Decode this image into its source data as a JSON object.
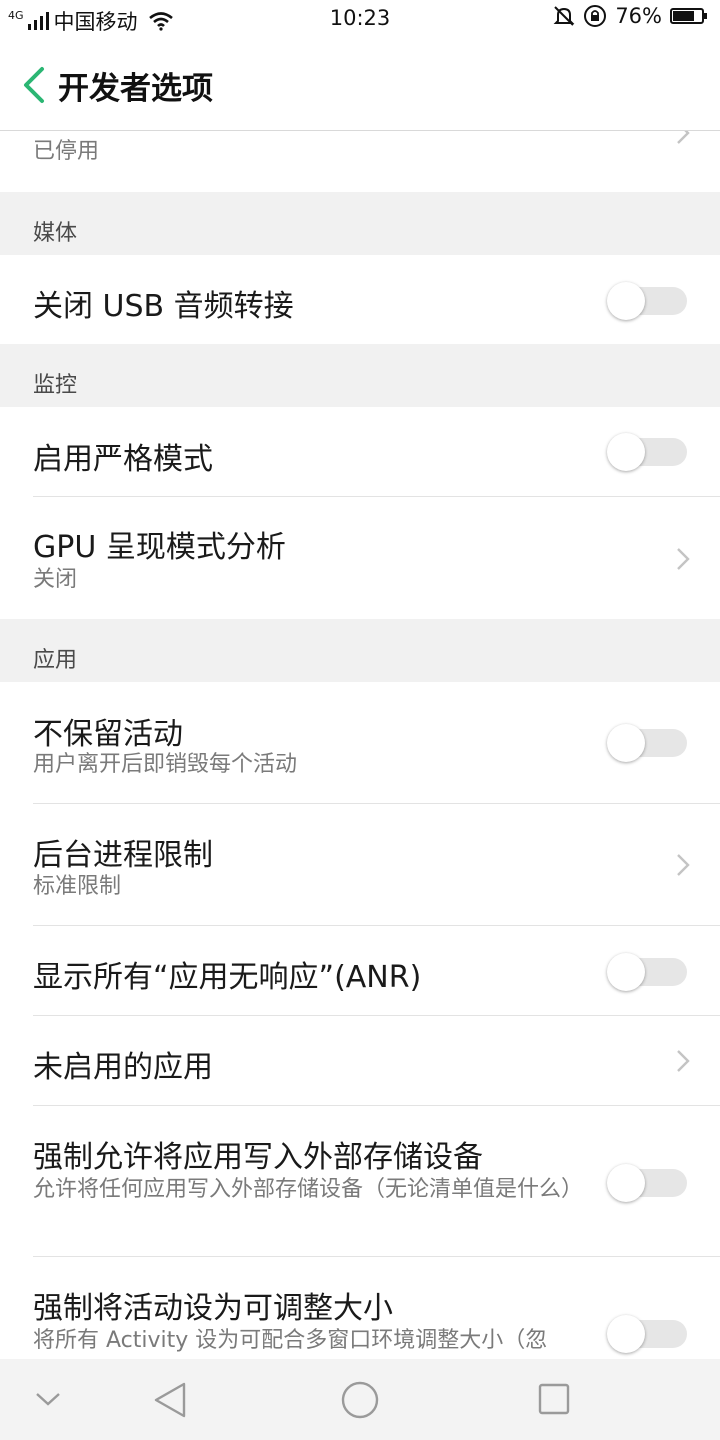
{
  "status_bar": {
    "network_type": "4G",
    "carrier": "中国移动",
    "time": "10:23",
    "battery_percent": "76%",
    "battery_level": 0.76
  },
  "header": {
    "title": "开发者选项"
  },
  "partial_top_row": {
    "summary": "已停用"
  },
  "sections": {
    "media": {
      "label": "媒体",
      "items": [
        {
          "title": "关闭 USB 音频转接",
          "control": "toggle",
          "on": false
        }
      ]
    },
    "monitoring": {
      "label": "监控",
      "items": [
        {
          "title": "启用严格模式",
          "control": "toggle",
          "on": false
        },
        {
          "title": "GPU 呈现模式分析",
          "summary": "关闭",
          "control": "chevron"
        }
      ]
    },
    "apps": {
      "label": "应用",
      "items": [
        {
          "title": "不保留活动",
          "summary": "用户离开后即销毁每个活动",
          "control": "toggle",
          "on": false
        },
        {
          "title": "后台进程限制",
          "summary": "标准限制",
          "control": "chevron"
        },
        {
          "title": "显示所有“应用无响应”(ANR)",
          "control": "toggle",
          "on": false
        },
        {
          "title": "未启用的应用",
          "control": "chevron"
        },
        {
          "title": "强制允许将应用写入外部存储设备",
          "summary": "允许将任何应用写入外部存储设备（无论清单值是什么）",
          "control": "toggle",
          "on": false
        },
        {
          "title": "强制将活动设为可调整大小",
          "summary": "将所有 Activity 设为可配合多窗口环境调整大小（忽",
          "control": "toggle",
          "on": false
        }
      ]
    }
  },
  "colors": {
    "accent": "#2bb673",
    "section_background": "#f1f1f1",
    "toggle_off_track": "#e6e6e6"
  },
  "nav_bar": {
    "icons": [
      "chevron-down-icon",
      "back-triangle-icon",
      "home-circle-icon",
      "recents-square-icon"
    ]
  }
}
